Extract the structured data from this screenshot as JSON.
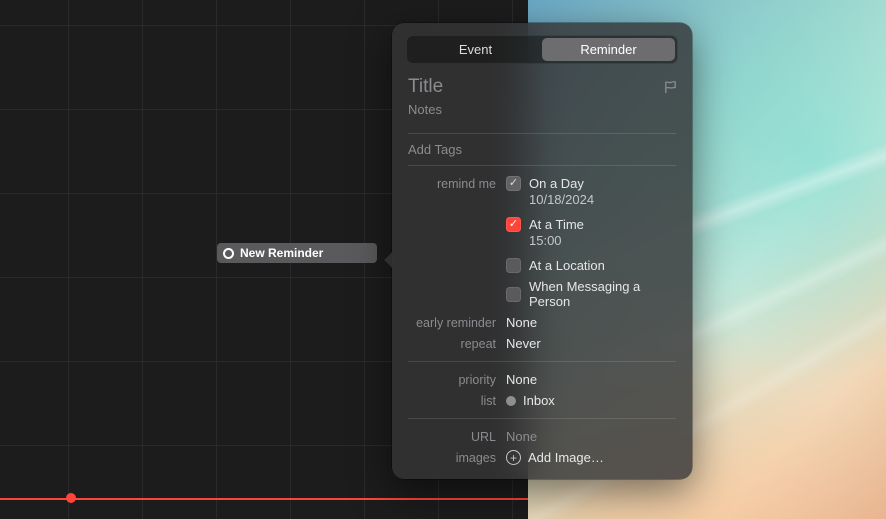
{
  "calendar": {
    "chip_label": "New Reminder"
  },
  "popover": {
    "segmented": {
      "event": "Event",
      "reminder": "Reminder",
      "selected": "reminder"
    },
    "title_placeholder": "Title",
    "notes_placeholder": "Notes",
    "tags_placeholder": "Add Tags",
    "labels": {
      "remind_me": "remind me",
      "early_reminder": "early reminder",
      "repeat": "repeat",
      "priority": "priority",
      "list": "list",
      "url": "URL",
      "images": "images"
    },
    "remind": {
      "on_a_day": {
        "label": "On a Day",
        "checked": true,
        "date": "10/18/2024"
      },
      "at_a_time": {
        "label": "At a Time",
        "checked": true,
        "time": "15:00"
      },
      "at_a_location": {
        "label": "At a Location",
        "checked": false
      },
      "when_messaging": {
        "label": "When Messaging a Person",
        "checked": false
      }
    },
    "early_reminder": "None",
    "repeat": "Never",
    "priority": "None",
    "list": {
      "name": "Inbox",
      "color": "#8e8e93"
    },
    "url": "None",
    "add_image": "Add Image…"
  }
}
